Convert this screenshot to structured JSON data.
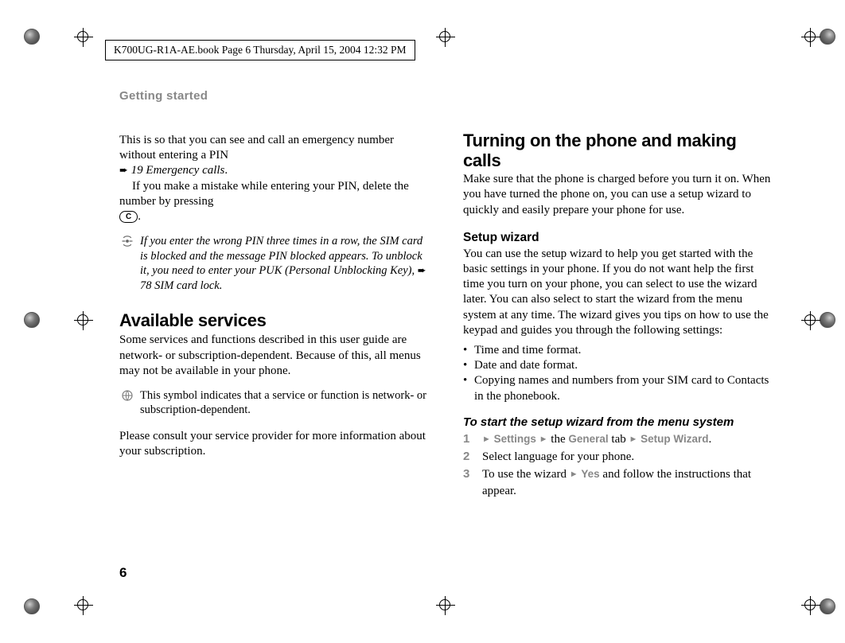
{
  "header": {
    "meta_line": "K700UG-R1A-AE.book  Page 6  Thursday, April 15, 2004  12:32 PM"
  },
  "section_label": "Getting started",
  "left": {
    "para1_line1": "This is so that you can see and call an emergency number without entering a PIN",
    "ref1": "19 Emergency calls",
    "para1_cont": "If you make a mistake while entering your PIN, delete the number by pressing ",
    "c_key": "C",
    "note1": "If you enter the wrong PIN three times in a row, the SIM card is blocked and the message PIN blocked appears. To unblock it, you need to enter your PUK (Personal Unblocking Key), ",
    "note1_ref": "78 SIM card lock.",
    "h2": "Available services",
    "para2": "Some services and functions described in this user guide are network- or subscription-dependent. Because of this, all menus may not be available in your phone.",
    "note2": "This symbol indicates that a service or function is network- or subscription-dependent.",
    "para3": "Please consult your service provider for more information about your subscription."
  },
  "right": {
    "h2": "Turning on the phone and making calls",
    "para1": "Make sure that the phone is charged before you turn it on. When you have turned the phone on, you can use a setup wizard to quickly and easily prepare your phone for use.",
    "h3": "Setup wizard",
    "para2": "You can use the setup wizard to help you get started with the basic settings in your phone. If you do not want help the first time you turn on your phone, you can select to use the wizard later. You can also select to start the wizard from the menu system at any time. The wizard gives you tips on how to use the keypad and guides you through the following settings:",
    "bullets": [
      "Time and time format.",
      "Date and date format.",
      "Copying names and numbers from your SIM card to Contacts in the phonebook."
    ],
    "proc_heading": "To start the setup wizard from the menu system",
    "steps": {
      "s1_settings": "Settings",
      "s1_the": " the ",
      "s1_general": "General",
      "s1_tab": " tab ",
      "s1_wizard": "Setup Wizard",
      "s2": "Select language for your phone.",
      "s3a": "To use the wizard ",
      "s3_yes": "Yes",
      "s3b": " and follow the instructions that appear."
    }
  },
  "page_number": "6"
}
